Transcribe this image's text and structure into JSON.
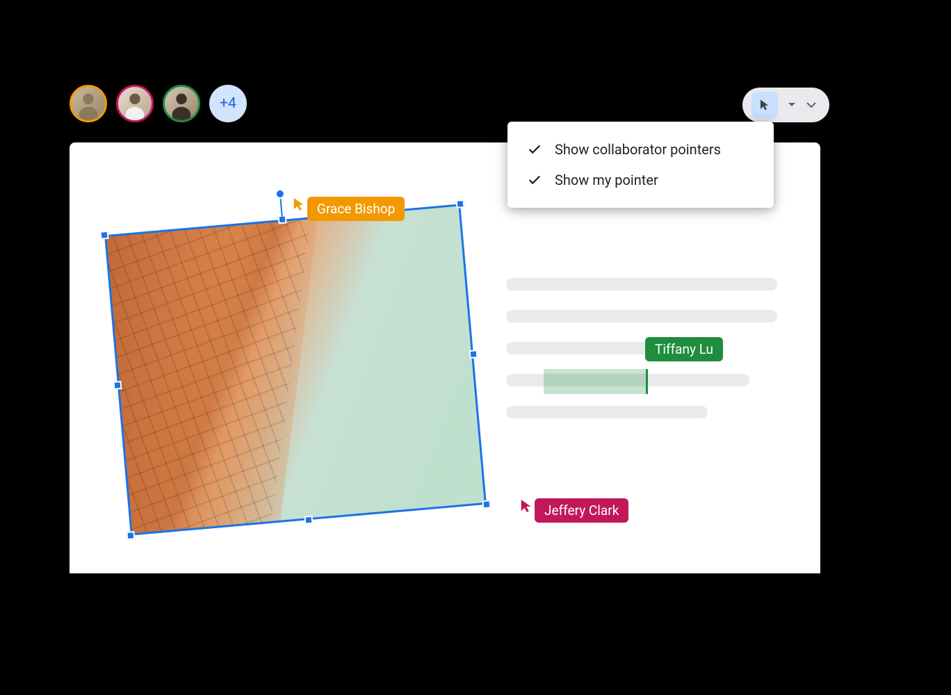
{
  "avatars": {
    "ring_colors": [
      "#f29900",
      "#c2185b",
      "#1e8e3e"
    ],
    "overflow_count": "+4"
  },
  "toolbar": {
    "pointer_active": true
  },
  "pointer_menu": {
    "items": [
      {
        "label": "Show collaborator pointers",
        "checked": true
      },
      {
        "label": "Show my pointer",
        "checked": true
      }
    ]
  },
  "collaborators": {
    "grace": {
      "name": "Grace Bishop",
      "color": "#f29900"
    },
    "jeffery": {
      "name": "Jeffery Clark",
      "color": "#c2185b"
    },
    "tiffany": {
      "name": "Tiffany Lu",
      "color": "#1e8e3e"
    }
  },
  "selection": {
    "object": "image",
    "rotation_deg": -5,
    "selected_by": "grace"
  }
}
